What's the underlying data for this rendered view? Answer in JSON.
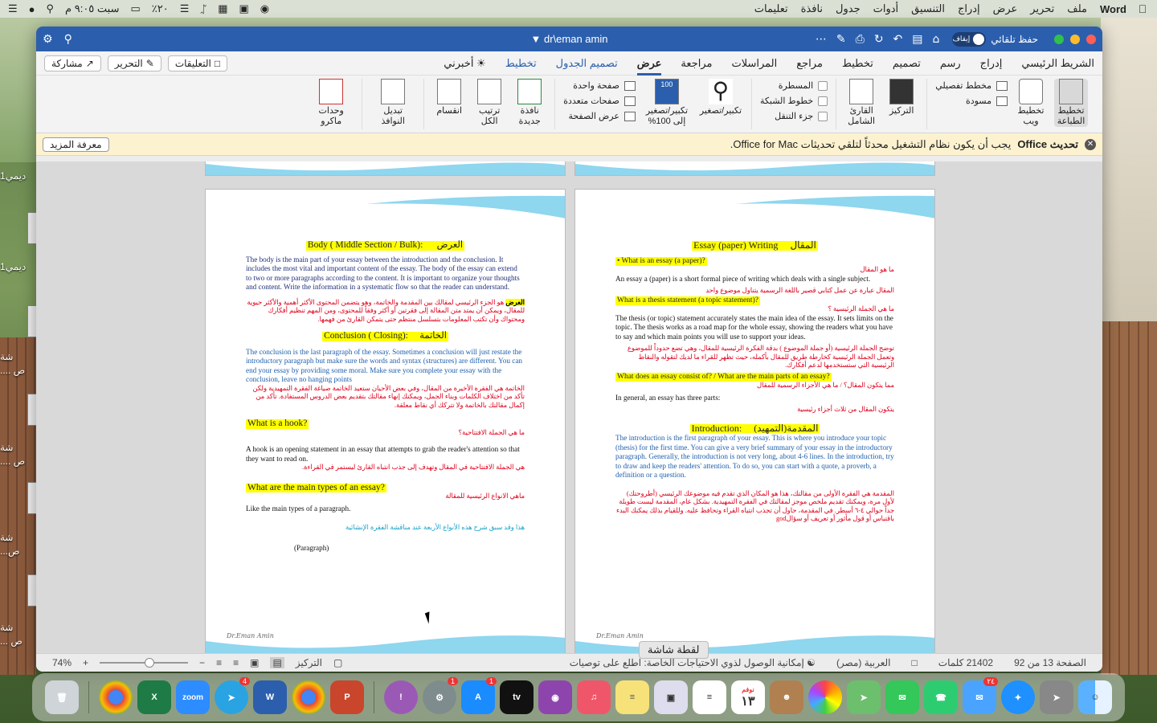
{
  "menubar": {
    "app": "Word",
    "items": [
      "ملف",
      "تحرير",
      "عرض",
      "إدراج",
      "التنسيق",
      "أدوات",
      "جدول",
      "نافذة",
      "تعليمات"
    ],
    "clock": "سبت ٩:٠٥ م",
    "battery": "٢٠٪"
  },
  "desktop": {
    "labels": [
      "ديمي1",
      "ديمي1",
      "شة",
      ".... ص",
      "شة",
      ".... ص",
      "شة",
      "...ص",
      "شة",
      "... ص"
    ]
  },
  "window": {
    "title": "dr\\eman amin",
    "autosave_label": "حفظ تلقائي",
    "autosave_state": "إيقاف",
    "tabs": [
      "الشريط الرئيسي",
      "إدراج",
      "رسم",
      "تصميم",
      "تخطيط",
      "مراجع",
      "المراسلات",
      "مراجعة",
      "عرض",
      "تصميم الجدول",
      "تخطيط",
      "أخبرني"
    ],
    "active_tab": "عرض",
    "share": "مشاركة",
    "edit": "التحرير",
    "comments": "التعليقات"
  },
  "ribbon": {
    "print_layout": "تخطيط الطباعة",
    "web_layout": "تخطيط ويب",
    "outline": "مخطط تفصيلي",
    "draft": "مسودة",
    "focus": "التركيز",
    "immersive": "القارئ الشامل",
    "ruler": "المسطرة",
    "gridlines": "خطوط الشبكة",
    "navpane": "جزء التنقل",
    "zoom": "تكبير/تصغير",
    "zoom100": "تكبير/تصغير إلى 100%",
    "one_page": "صفحة واحدة",
    "multi_page": "صفحات متعددة",
    "page_width": "عرض الصفحة",
    "new_window": "نافذة جديدة",
    "arrange": "ترتيب الكل",
    "split": "انقسام",
    "switch": "تبديل النوافذ",
    "macros": "وحدات ماكرو"
  },
  "message": {
    "title": "تحديث Office",
    "text": "يجب أن يكون نظام التشغيل محدثاً لتلقي تحديثات Office for Mac.",
    "button": "معرفة المزيد"
  },
  "page_left": {
    "body_heading": "Body ( Middle Section / Bulk):",
    "body_heading_ar": "العرض",
    "body_text": "The body is the main part of your essay between the introduction and the conclusion. It includes the most vital and important content of the essay. The body of the essay can extend to two or more paragraphs according to the content. It is important to organize your thoughts and content. Write the information in a systematic flow so that the reader can understand.",
    "body_ar_lead": "العرض",
    "body_ar": " هو الجزء الرئيسي لمقالك بين المقدمة والخاتمة، وهو يتضمن المحتوى الأكثر أهمية والأكثر حيوية للمقال، ويمكن أن يمتد متن المقالة إلى فقرتين أو أكثر وفقاً للمحتوى، ومن المهم تنظيم أفكارك ومحتواك وأن تكتب المعلومات بتسلسل منتظم حتى يتمكن القارئ من فهمها.",
    "conclusion_heading": "Conclusion ( Closing):",
    "conclusion_heading_ar": "الخاتمة",
    "conclusion_text": "The conclusion is the last paragraph of the essay. Sometimes a conclusion will just restate the introductory paragraph but make sure the words and syntax (structures) are different. You can end your essay by providing some moral. Make sure you complete your essay with the conclusion, leave no hanging points",
    "conclusion_ar": "الخاتمة هي الفقرة الأخيرة من المقال، وفي بعض الأحيان ستعيد الخاتمة صياغة الفقرة التمهيدية ولكن تأكد من اختلاف الكلمات وبناء الجمل، ويمكنك إنهاء مقالتك بتقديم بعض الدروس المستفادة. تأكد من إكمال مقالتك بالخاتمة ولا تتركك أي نقاط معلقة.",
    "hook_heading": "What is a hook?",
    "hook_ar_q": "ما هي الجملة الافتتاحية؟",
    "hook_text": "A hook is an opening statement in an essay that attempts to grab the reader's attention so that they want to read on.",
    "hook_ar": "هي الجملة الافتتاحية في المقال وتهدف إلى جذب انتباه القارئ ليستمر في القراءة.",
    "types_heading": "What are the main types of an essay?",
    "types_ar_q": "ماهي الانواع الرئيسية للمقالة",
    "types_text": "Like the main types of a paragraph.",
    "types_ar": "هذا وقد سبق شرح هذه الأنواع الأربعة عند مناقشة الفقرة الإنشائية",
    "paragraph_note": "(Paragraph)",
    "footer": "Dr.Eman Amin"
  },
  "page_right": {
    "title": "Essay (paper) Writing",
    "title_ar": "المقال",
    "q1": "• What is an essay (a paper)?",
    "q1_ar": "ما هو المقال",
    "a1": "An essay a (paper) is a short formal piece of writing which deals with a single subject.",
    "a1_ar": "المقال عبارة عن عمل كتابي قصير باللغة الرسمية يتناول موضوع واحد",
    "q2": "What is a thesis statement (a topic statement)?",
    "q2_ar": "ما هي الجملة الرئيسية ؟",
    "a2": "The thesis (or topic) statement accurately states the main idea of the essay. It sets limits on the topic. The thesis works as a road map for the whole essay, showing the readers what you have to say and which main points you will use to support your ideas.",
    "a2_ar": "توضح الجملة الرئيسية (أو جملة الموضوع ) بدقة الفكرة الرئيسية للمقال، وهي تضع حدوداً للموضوع وتعمل الجملة الرئيسية كخارطة طريق للمقال بأكمله، حيث تظهر للقراء ما لديك لتقوله والنقاط الرئيسية التي ستستخدمها لدعم أفكارك.",
    "q3": "What does an essay consist of? / What are the main parts of an essay?",
    "q3_ar": "مما يتكون المقال؟ / ما هي الأجزاء الرسمية للمقال",
    "a3": "In general, an essay has three parts:",
    "a3_ar": "يتكون المقال من ثلاث أجزاء رئيسية",
    "intro_heading": "Introduction:",
    "intro_heading_ar": "المقدمة(التمهيد)",
    "intro_text": "The introduction is the first paragraph of your essay. This is where you introduce your topic (thesis) for the first time. You can give a very brief summary of your essay in the introductory paragraph. Generally, the introduction is not very long, about 4-6 lines. In the introduction, try to draw and keep the readers' attention. To do so, you can start with a quote, a proverb, a definition or a question.",
    "intro_ar": "المقدمة هي الفقرة الأولى من مقالتك، هذا هو المكان الذي تقدم فيه موضوعك الرئيسي (أطروحتك) لأول مرة، ويمكنك تقديم ملخص موجز لمقالتك في الفقرة التمهيدية. بشكل عام، المقدمة ليست طويلة جداً حوالي ٤-٦ أسطر. في المقدمة، حاول أن تجذب انتباه القراء وتحافظ عليه. وللقيام بذلك يمكنك البدء باقتباس أو قول مأثور أو تعريف أو سؤالgod",
    "footer": "Dr.Eman Amin"
  },
  "statusbar": {
    "page": "الصفحة 13 من 92",
    "words": "21402 كلمات",
    "language": "العربية (مصر)",
    "accessibility": "إمكانية الوصول لذوي الاحتياجات الخاصة: اطلع على توصيات",
    "focus": "التركيز",
    "zoom": "74%"
  },
  "tooltip": "لقطة شاشة",
  "dock": {
    "apps": [
      "Trash",
      "Chrome",
      "Excel",
      "Zoom",
      "Telegram",
      "Word",
      "Chrome",
      "PowerPoint",
      "Feedback",
      "Settings",
      "App Store",
      "TV",
      "Podcasts",
      "Music",
      "Notes",
      "Screenshot",
      "Reminders",
      "Calendar",
      "Contacts",
      "Photos",
      "Maps",
      "Messages",
      "FaceTime",
      "Mail",
      "Safari",
      "Launchpad",
      "Finder"
    ],
    "badges": {
      "telegram": "4",
      "settings": "1",
      "appstore": "1",
      "mail": "٢٤"
    },
    "calendar_day": "١٣",
    "calendar_month": "نوفم"
  }
}
